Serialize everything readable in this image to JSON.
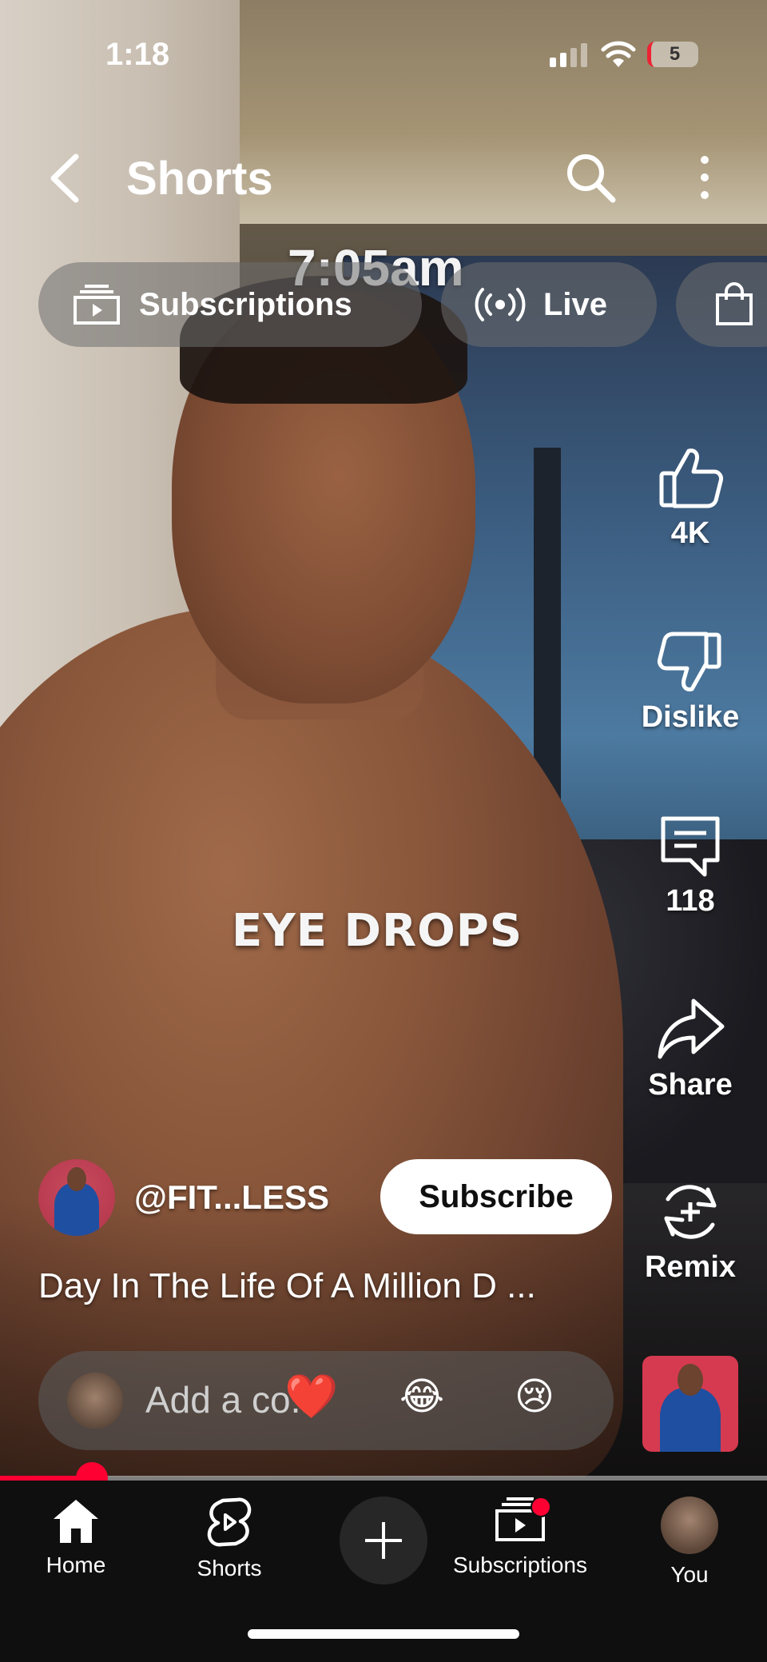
{
  "status_bar": {
    "time": "1:18",
    "battery": "5"
  },
  "header": {
    "title": "Shorts"
  },
  "overlay_clock": "7:05am",
  "chips": [
    {
      "label": "Subscriptions"
    },
    {
      "label": "Live"
    },
    {
      "label": ""
    }
  ],
  "video_caption": "EYE DROPS",
  "actions": {
    "like": "4K",
    "dislike": "Dislike",
    "comments": "118",
    "share": "Share",
    "remix": "Remix"
  },
  "channel": {
    "name": "@FIT...LESS",
    "subscribe_label": "Subscribe"
  },
  "video_title": "Day In The Life Of A Million D ...",
  "comment_bar": {
    "placeholder": "Add a co...",
    "emojis": [
      "❤️",
      "😂",
      "😢"
    ]
  },
  "progress": {
    "played_fraction": 0.12
  },
  "bottom_nav": [
    {
      "label": "Home"
    },
    {
      "label": "Shorts"
    },
    {
      "label": "Subscriptions"
    },
    {
      "label": "You"
    }
  ],
  "colors": {
    "accent": "#ff0033",
    "nav_bg": "#0f0f0f"
  },
  "icons": [
    "back-arrow-icon",
    "search-icon",
    "more-vertical-icon",
    "subscriptions-icon",
    "live-icon",
    "shopping-bag-icon",
    "thumbs-up-icon",
    "thumbs-down-icon",
    "comment-icon",
    "share-icon",
    "remix-icon",
    "home-icon",
    "shorts-icon",
    "create-icon"
  ]
}
